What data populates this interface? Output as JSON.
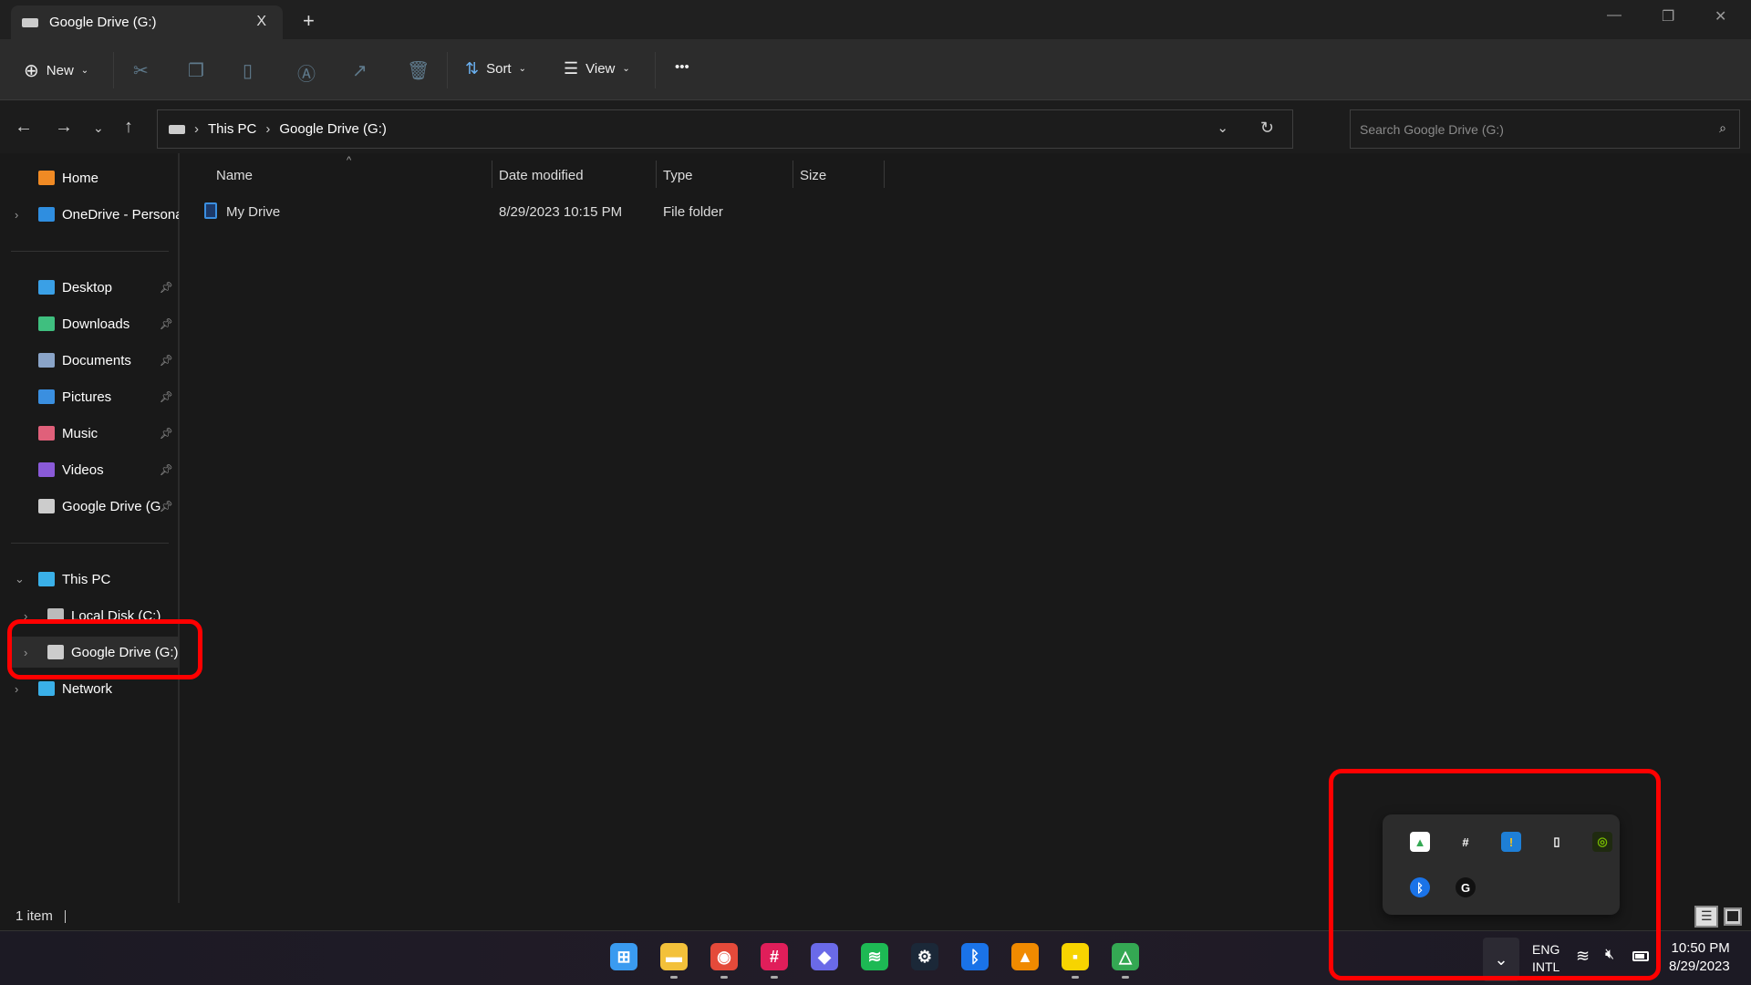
{
  "window": {
    "tab_title": "Google Drive (G:)",
    "new_tab": "+",
    "close_tab": "X",
    "minimize": "—",
    "maximize": "❐",
    "close": "✕"
  },
  "toolbar": {
    "new_label": "New",
    "sort_label": "Sort",
    "view_label": "View",
    "more": "•••"
  },
  "address": {
    "crumbs": [
      "This PC",
      "Google Drive (G:)"
    ],
    "search_placeholder": "Search Google Drive (G:)"
  },
  "sidebar": {
    "items": [
      {
        "label": "Home",
        "icon": "home-icon",
        "color": "#f08a24"
      },
      {
        "label": "OneDrive - Persona",
        "icon": "cloud-icon",
        "color": "#2f8ee0",
        "chev": "›"
      },
      {
        "label": "Desktop",
        "icon": "desktop-icon",
        "color": "#3aa0e6",
        "pin": true
      },
      {
        "label": "Downloads",
        "icon": "download-icon",
        "color": "#3fbf7f",
        "pin": true
      },
      {
        "label": "Documents",
        "icon": "documents-icon",
        "color": "#8aa4c8",
        "pin": true
      },
      {
        "label": "Pictures",
        "icon": "pictures-icon",
        "color": "#3a8fe0",
        "pin": true
      },
      {
        "label": "Music",
        "icon": "music-icon",
        "color": "#e0607a",
        "pin": true
      },
      {
        "label": "Videos",
        "icon": "videos-icon",
        "color": "#8a5ad8",
        "pin": true
      },
      {
        "label": "Google Drive (G",
        "icon": "drive-icon",
        "color": "#cccccc",
        "pin": true
      },
      {
        "label": "This PC",
        "icon": "computer-icon",
        "color": "#3ab0e8",
        "chev": "⌄"
      },
      {
        "label": "Local Disk (C:)",
        "icon": "disk-icon",
        "color": "#bbbbbb",
        "chev": "›"
      },
      {
        "label": "Google Drive (G:)",
        "icon": "drive-icon",
        "color": "#cccccc",
        "chev": "›",
        "selected": true
      },
      {
        "label": "Network",
        "icon": "network-icon",
        "color": "#3ab0e8",
        "chev": "›"
      }
    ]
  },
  "columns": [
    "Name",
    "Date modified",
    "Type",
    "Size"
  ],
  "files": [
    {
      "name": "My Drive",
      "date": "8/29/2023 10:15 PM",
      "type": "File folder",
      "size": ""
    }
  ],
  "status": {
    "count": "1 item"
  },
  "taskbar": {
    "apps": [
      {
        "name": "start",
        "color": "#3a9bf0",
        "glyph": "⊞"
      },
      {
        "name": "file-explorer",
        "color": "#f3c13a",
        "glyph": "▬"
      },
      {
        "name": "chrome",
        "color": "#e44a3a",
        "glyph": "◉"
      },
      {
        "name": "slack",
        "color": "#e01e5a",
        "glyph": "#"
      },
      {
        "name": "copilot",
        "color": "#6a6ae8",
        "glyph": "◆"
      },
      {
        "name": "spotify",
        "color": "#1db954",
        "glyph": "≋"
      },
      {
        "name": "steam",
        "color": "#1b2838",
        "glyph": "⚙"
      },
      {
        "name": "bluetooth",
        "color": "#1a73e8",
        "glyph": "ᛒ"
      },
      {
        "name": "vlc",
        "color": "#f08a00",
        "glyph": "▲"
      },
      {
        "name": "sticky-notes",
        "color": "#f7d400",
        "glyph": "▪"
      },
      {
        "name": "google-drive",
        "color": "#34a853",
        "glyph": "△"
      }
    ],
    "lang1": "ENG",
    "lang2": "INTL",
    "time": "10:50 PM",
    "date": "8/29/2023"
  },
  "tray": {
    "icons": [
      {
        "name": "google-drive",
        "bg": "#ffffff",
        "fg": "#34a853",
        "glyph": "▲"
      },
      {
        "name": "slack",
        "bg": "transparent",
        "fg": "#ffffff",
        "glyph": "#"
      },
      {
        "name": "windows-security-warning",
        "bg": "#1e7fd6",
        "fg": "#f7c21a",
        "glyph": "!"
      },
      {
        "name": "usb-safely-remove",
        "bg": "transparent",
        "fg": "#ffffff",
        "glyph": "▯"
      },
      {
        "name": "nvidia",
        "bg": "#1f2a10",
        "fg": "#76b900",
        "glyph": "◎"
      },
      {
        "name": "bluetooth",
        "bg": "#1a73e8",
        "fg": "#ffffff",
        "glyph": "ᛒ"
      },
      {
        "name": "logitech-g-hub",
        "bg": "#111111",
        "fg": "#ffffff",
        "glyph": "G"
      }
    ]
  },
  "annotation_color": "#ff0000"
}
